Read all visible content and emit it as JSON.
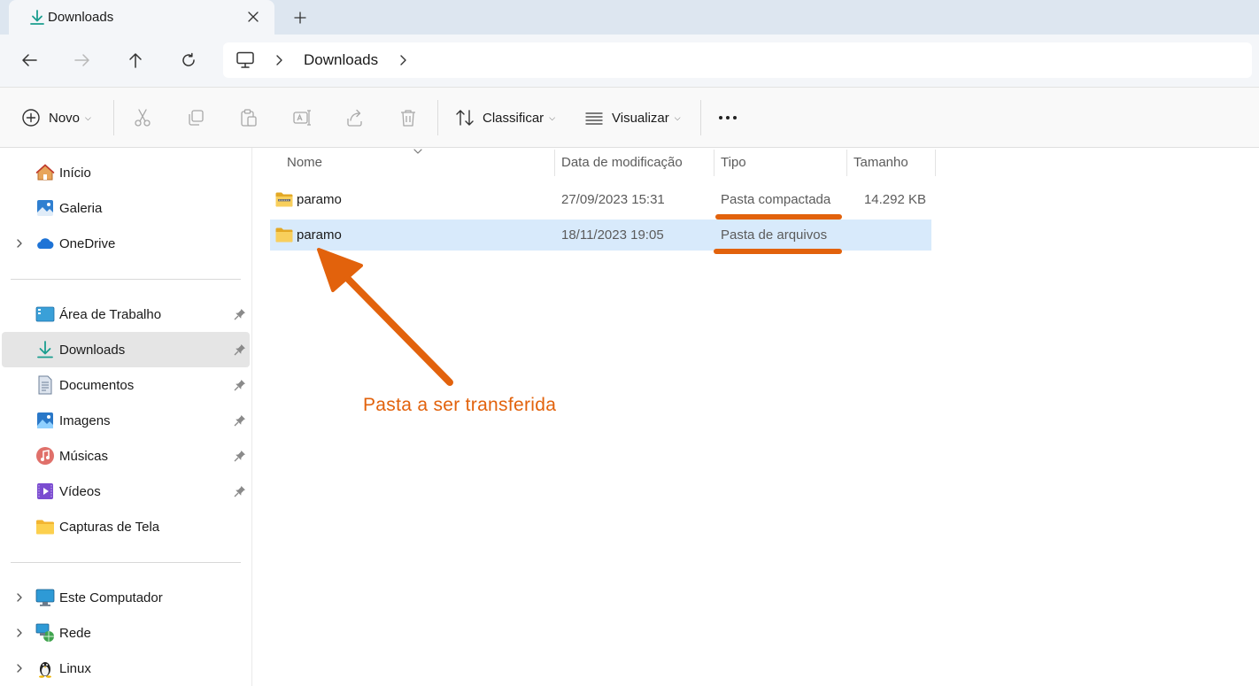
{
  "tab": {
    "title": "Downloads"
  },
  "address": {
    "crumbs": [
      "Downloads"
    ]
  },
  "toolbar": {
    "new_label": "Novo",
    "sort_label": "Classificar",
    "view_label": "Visualizar",
    "more_label": "···"
  },
  "sidebar": {
    "top": [
      {
        "label": "Início",
        "icon": "home-icon"
      },
      {
        "label": "Galeria",
        "icon": "gallery-icon"
      },
      {
        "label": "OneDrive",
        "icon": "cloud-icon"
      }
    ],
    "quick": [
      {
        "label": "Área de Trabalho",
        "icon": "desktop-icon",
        "pinned": true
      },
      {
        "label": "Downloads",
        "icon": "download-icon",
        "pinned": true,
        "selected": true
      },
      {
        "label": "Documentos",
        "icon": "document-icon",
        "pinned": true
      },
      {
        "label": "Imagens",
        "icon": "image-icon",
        "pinned": true
      },
      {
        "label": "Músicas",
        "icon": "music-icon",
        "pinned": true
      },
      {
        "label": "Vídeos",
        "icon": "video-icon",
        "pinned": true
      },
      {
        "label": "Capturas de Tela",
        "icon": "folder-icon",
        "pinned": false
      }
    ],
    "bottom": [
      {
        "label": "Este Computador",
        "icon": "computer-icon"
      },
      {
        "label": "Rede",
        "icon": "network-icon"
      },
      {
        "label": "Linux",
        "icon": "linux-icon"
      }
    ]
  },
  "columns": {
    "name": "Nome",
    "date": "Data de modificação",
    "type": "Tipo",
    "size": "Tamanho"
  },
  "files": [
    {
      "name": "paramo",
      "date": "27/09/2023 15:31",
      "type": "Pasta compactada",
      "size": "14.292 KB",
      "icon": "zip-folder-icon",
      "selected": false
    },
    {
      "name": "paramo",
      "date": "18/11/2023 19:05",
      "type": "Pasta de arquivos",
      "size": "",
      "icon": "folder-icon",
      "selected": true
    }
  ],
  "annotation": {
    "text": "Pasta a ser transferida",
    "color": "#e2620c"
  },
  "colors": {
    "accent": "#0078d4",
    "selection": "#d8eafb",
    "annotation": "#e2620c"
  }
}
